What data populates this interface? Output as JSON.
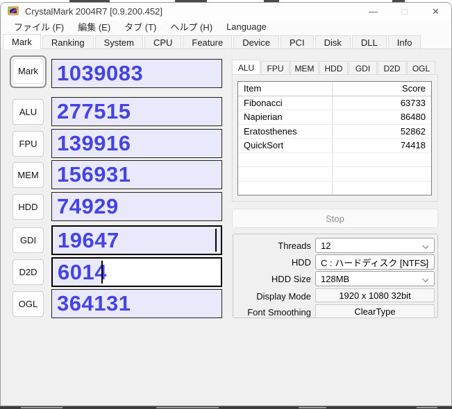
{
  "titlebar": {
    "title": "CrystalMark 2004R7 [0.9.200.452]",
    "minimize_glyph": "—",
    "maximize_glyph": "□",
    "close_glyph": "✕"
  },
  "menu": {
    "items": [
      "ファイル (F)",
      "編集 (E)",
      "タブ (T)",
      "ヘルプ (H)",
      "Language"
    ]
  },
  "main_tabs": {
    "active": "Mark",
    "items": [
      "Mark",
      "Ranking",
      "System",
      "CPU",
      "Feature",
      "Device",
      "PCI",
      "Disk",
      "DLL",
      "Info"
    ]
  },
  "benchmark": {
    "rows": [
      {
        "label": "Mark",
        "score": "1039083",
        "fill": "100%"
      },
      {
        "label": "ALU",
        "score": "277515",
        "fill": "100%"
      },
      {
        "label": "FPU",
        "score": "139916",
        "fill": "100%"
      },
      {
        "label": "MEM",
        "score": "156931",
        "fill": "100%"
      },
      {
        "label": "HDD",
        "score": "74929",
        "fill": "100%"
      },
      {
        "label": "GDI",
        "score": "19647",
        "fill": "100%",
        "caret": "96.5%"
      },
      {
        "label": "D2D",
        "score": "6014",
        "fill": "29%",
        "caret": "29%"
      },
      {
        "label": "OGL",
        "score": "364131",
        "fill": "100%"
      }
    ]
  },
  "result_panel": {
    "active_tab": "ALU",
    "tabs": [
      "ALU",
      "FPU",
      "MEM",
      "HDD",
      "GDI",
      "D2D",
      "OGL"
    ],
    "table": {
      "headers": [
        "Item",
        "Score"
      ],
      "rows": [
        [
          "Fibonacci",
          "63733"
        ],
        [
          "Napierian",
          "86480"
        ],
        [
          "Eratosthenes",
          "52862"
        ],
        [
          "QuickSort",
          "74418"
        ]
      ]
    }
  },
  "controls": {
    "stop_label": "Stop",
    "fields": [
      {
        "label": "Threads",
        "value": "12",
        "control": "select"
      },
      {
        "label": "HDD",
        "value": "C : ハードディスク [NTFS]",
        "control": "select"
      },
      {
        "label": "HDD Size",
        "value": "128MB",
        "control": "select"
      },
      {
        "label": "Display Mode",
        "value": "1920 x 1080 32bit",
        "control": "button"
      },
      {
        "label": "Font Smoothing",
        "value": "ClearType",
        "control": "button"
      }
    ]
  },
  "colors": {
    "score_text": "#4444e4",
    "score_fill_bg": "#e9e9fb",
    "client_bg": "#f0f0f0",
    "titlebar_bg": "#fdfdfd"
  }
}
